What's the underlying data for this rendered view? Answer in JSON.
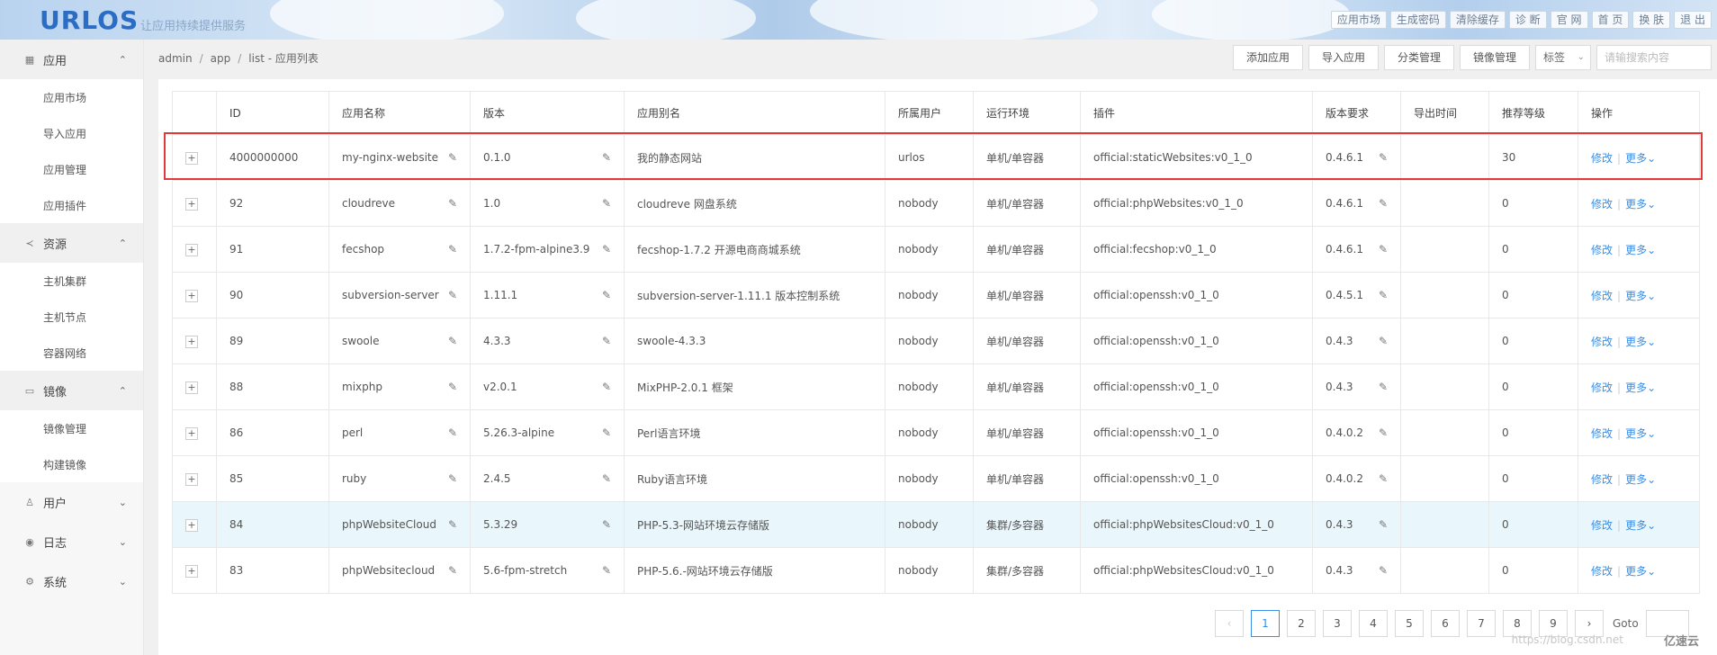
{
  "header": {
    "logo": "URLOS",
    "subtitle": "让应用持续提供服务",
    "links": [
      "应用市场",
      "生成密码",
      "清除缓存",
      "诊 断",
      "官 网",
      "首 页",
      "换 肤",
      "退 出"
    ]
  },
  "sidebar": {
    "groups": [
      {
        "label": "应用",
        "icon": "grid-icon",
        "open": true,
        "items": [
          "应用市场",
          "导入应用",
          "应用管理",
          "应用插件"
        ]
      },
      {
        "label": "资源",
        "icon": "share-icon",
        "open": true,
        "items": [
          "主机集群",
          "主机节点",
          "容器网络"
        ]
      },
      {
        "label": "镜像",
        "icon": "disk-icon",
        "open": true,
        "items": [
          "镜像管理",
          "构建镜像"
        ]
      },
      {
        "label": "用户",
        "icon": "user-icon",
        "open": false,
        "items": []
      },
      {
        "label": "日志",
        "icon": "eye-icon",
        "open": false,
        "items": []
      },
      {
        "label": "系统",
        "icon": "gear-icon",
        "open": false,
        "items": []
      }
    ]
  },
  "breadcrumb": {
    "parts": [
      "admin",
      "app",
      "list - 应用列表"
    ]
  },
  "toolbar": {
    "add_app": "添加应用",
    "import_app": "导入应用",
    "category": "分类管理",
    "images": "镜像管理",
    "tag_select": "标签",
    "search_placeholder": "请输搜索内容"
  },
  "table": {
    "columns": [
      "",
      "ID",
      "应用名称",
      "版本",
      "应用别名",
      "所属用户",
      "运行环境",
      "插件",
      "版本要求",
      "导出时间",
      "推荐等级",
      "操作"
    ],
    "edit_label": "修改",
    "more_label": "更多",
    "rows": [
      {
        "id": "4000000000",
        "name": "my-nginx-website",
        "version": "0.1.0",
        "alias": "我的静态网站",
        "user": "urlos",
        "env": "单机/单容器",
        "plugin": "official:staticWebsites:v0_1_0",
        "req": "0.4.6.1",
        "export": "",
        "level": "30",
        "highlight": false,
        "boxed": true
      },
      {
        "id": "92",
        "name": "cloudreve",
        "version": "1.0",
        "alias": "cloudreve 网盘系统",
        "user": "nobody",
        "env": "单机/单容器",
        "plugin": "official:phpWebsites:v0_1_0",
        "req": "0.4.6.1",
        "export": "",
        "level": "0",
        "highlight": false
      },
      {
        "id": "91",
        "name": "fecshop",
        "version": "1.7.2-fpm-alpine3.9",
        "alias": "fecshop-1.7.2 开源电商商城系统",
        "user": "nobody",
        "env": "单机/单容器",
        "plugin": "official:fecshop:v0_1_0",
        "req": "0.4.6.1",
        "export": "",
        "level": "0",
        "highlight": false
      },
      {
        "id": "90",
        "name": "subversion-server",
        "version": "1.11.1",
        "alias": "subversion-server-1.11.1 版本控制系统",
        "user": "nobody",
        "env": "单机/单容器",
        "plugin": "official:openssh:v0_1_0",
        "req": "0.4.5.1",
        "export": "",
        "level": "0",
        "highlight": false
      },
      {
        "id": "89",
        "name": "swoole",
        "version": "4.3.3",
        "alias": "swoole-4.3.3",
        "user": "nobody",
        "env": "单机/单容器",
        "plugin": "official:openssh:v0_1_0",
        "req": "0.4.3",
        "export": "",
        "level": "0",
        "highlight": false
      },
      {
        "id": "88",
        "name": "mixphp",
        "version": "v2.0.1",
        "alias": "MixPHP-2.0.1 框架",
        "user": "nobody",
        "env": "单机/单容器",
        "plugin": "official:openssh:v0_1_0",
        "req": "0.4.3",
        "export": "",
        "level": "0",
        "highlight": false
      },
      {
        "id": "86",
        "name": "perl",
        "version": "5.26.3-alpine",
        "alias": "Perl语言环境",
        "user": "nobody",
        "env": "单机/单容器",
        "plugin": "official:openssh:v0_1_0",
        "req": "0.4.0.2",
        "export": "",
        "level": "0",
        "highlight": false
      },
      {
        "id": "85",
        "name": "ruby",
        "version": "2.4.5",
        "alias": "Ruby语言环境",
        "user": "nobody",
        "env": "单机/单容器",
        "plugin": "official:openssh:v0_1_0",
        "req": "0.4.0.2",
        "export": "",
        "level": "0",
        "highlight": false
      },
      {
        "id": "84",
        "name": "phpWebsiteCloud",
        "version": "5.3.29",
        "alias": "PHP-5.3-网站环境云存储版",
        "user": "nobody",
        "env": "集群/多容器",
        "plugin": "official:phpWebsitesCloud:v0_1_0",
        "req": "0.4.3",
        "export": "",
        "level": "0",
        "highlight": true
      },
      {
        "id": "83",
        "name": "phpWebsitecloud",
        "version": "5.6-fpm-stretch",
        "alias": "PHP-5.6.-网站环境云存储版",
        "user": "nobody",
        "env": "集群/多容器",
        "plugin": "official:phpWebsitesCloud:v0_1_0",
        "req": "0.4.3",
        "export": "",
        "level": "0",
        "highlight": false
      }
    ]
  },
  "pagination": {
    "pages": [
      "1",
      "2",
      "3",
      "4",
      "5",
      "6",
      "7",
      "8",
      "9"
    ],
    "current": "1",
    "prev": "‹",
    "next": "›",
    "goto_label": "Goto"
  },
  "watermark": {
    "url": "https://blog.csdn.net",
    "brand": "亿速云"
  },
  "colors": {
    "accent": "#3a8ee6",
    "highlight_row": "#e9f6fc",
    "annotation_box": "#e23a3a"
  }
}
